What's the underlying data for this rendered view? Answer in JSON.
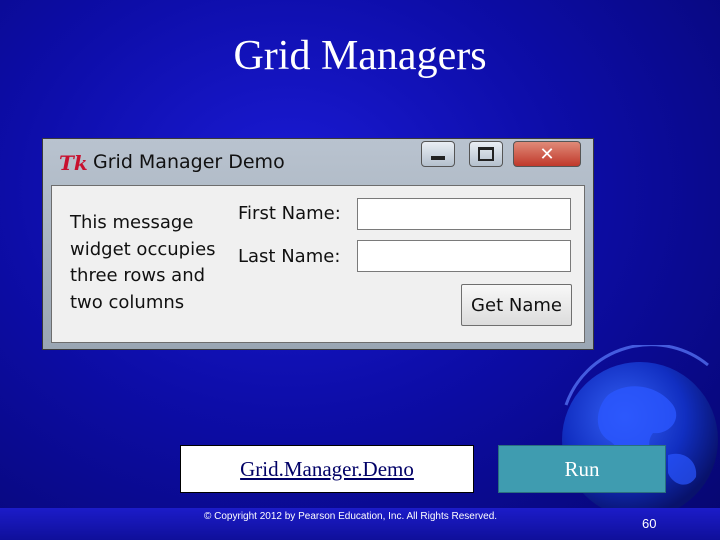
{
  "slide": {
    "title": "Grid Managers",
    "demo_link_label": "Grid.Manager.Demo",
    "run_button_label": "Run",
    "copyright": "© Copyright 2012 by Pearson Education, Inc. All Rights Reserved.",
    "page_number": "60"
  },
  "window": {
    "app_icon": "Tk",
    "title": "Grid Manager Demo",
    "controls": {
      "minimize": "minimize-icon",
      "maximize": "maximize-icon",
      "close": "✕"
    },
    "message_lines": [
      "This message",
      "widget occupies",
      "three rows and",
      "two columns"
    ],
    "first_name_label": "First Name:",
    "first_name_value": "",
    "last_name_label": "Last Name:",
    "last_name_value": "",
    "get_name_button": "Get Name"
  },
  "colors": {
    "background": "#0d0da8",
    "run_button": "#3f9cb0",
    "close_button": "#c0392b",
    "tk_logo": "#c8102e"
  }
}
